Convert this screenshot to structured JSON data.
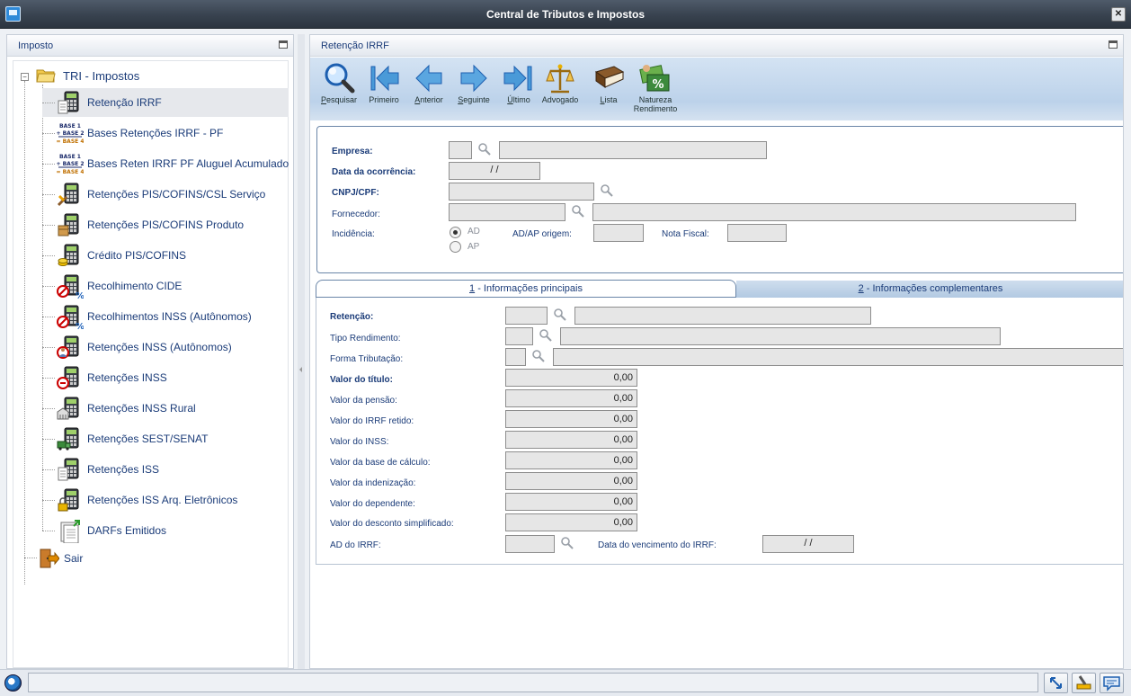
{
  "window": {
    "title": "Central de Tributos e Impostos"
  },
  "left": {
    "header": "Imposto",
    "root": "TRI - Impostos",
    "items": [
      {
        "label": "Retenção IRRF",
        "icon": "document-calculator-icon",
        "selected": true
      },
      {
        "label": "Bases Retenções IRRF - PF",
        "icon": "base-sum-icon"
      },
      {
        "label": "Bases Reten IRRF PF Aluguel Acumulado",
        "icon": "base-sum-icon"
      },
      {
        "label": "Retenções PIS/COFINS/CSL Serviço",
        "icon": "tools-calculator-icon"
      },
      {
        "label": "Retenções PIS/COFINS Produto",
        "icon": "box-calculator-icon"
      },
      {
        "label": "Crédito PIS/COFINS",
        "icon": "coins-calculator-icon"
      },
      {
        "label": "Recolhimento CIDE",
        "icon": "percent-calculator-icon"
      },
      {
        "label": "Recolhimentos INSS (Autônomos)",
        "icon": "percent-calculator-icon"
      },
      {
        "label": "Retenções INSS (Autônomos)",
        "icon": "person-calculator-icon"
      },
      {
        "label": "Retenções INSS",
        "icon": "calculator-badge-icon"
      },
      {
        "label": "Retenções INSS Rural",
        "icon": "building-calculator-icon"
      },
      {
        "label": "Retenções SEST/SENAT",
        "icon": "truck-calculator-icon"
      },
      {
        "label": "Retenções ISS",
        "icon": "document-calculator-icon"
      },
      {
        "label": "Retenções ISS Arq. Eletrônicos",
        "icon": "lock-calculator-icon"
      },
      {
        "label": "DARFs Emitidos",
        "icon": "documents-arrow-icon"
      }
    ],
    "exit": "Sair"
  },
  "right": {
    "header": "Retenção IRRF",
    "toolbar": [
      {
        "label": "Pesquisar",
        "u": "P",
        "rest": "esquisar",
        "icon": "magnifier-icon"
      },
      {
        "label": "Primeiro",
        "u": "",
        "rest": "Primeiro",
        "icon": "first-arrow-icon"
      },
      {
        "label": "Anterior",
        "u": "A",
        "rest": "nterior",
        "icon": "prev-arrow-icon"
      },
      {
        "label": "Seguinte",
        "u": "S",
        "rest": "eguinte",
        "icon": "next-arrow-icon"
      },
      {
        "label": "Último",
        "u": "Ú",
        "rest": "ltimo",
        "icon": "last-arrow-icon"
      },
      {
        "label": "Advogado",
        "u": "",
        "rest": "Advogado",
        "icon": "scales-icon"
      },
      {
        "label": "Lista",
        "u": "L",
        "rest": "ista",
        "icon": "book-icon"
      },
      {
        "label": "Natureza Rendimento",
        "u": "",
        "rest": "Natureza",
        "rest2": "Rendimento",
        "icon": "money-percent-icon"
      }
    ],
    "form": {
      "empresa": "Empresa:",
      "data_ocorrencia": "Data da ocorrência:",
      "data_ocorrencia_value": "/ /",
      "cnpj": "CNPJ/CPF:",
      "fornecedor": "Fornecedor:",
      "incidencia": "Incidência:",
      "opt_ad": "AD",
      "opt_ap": "AP",
      "adap_origem": "AD/AP origem:",
      "nota_fiscal": "Nota Fiscal:"
    },
    "tabs": {
      "tab1_num": "1",
      "tab1_label": " - Informações principais",
      "tab2_num": "2",
      "tab2_label": " - Informações complementares"
    },
    "details": {
      "retencao": "Retenção:",
      "tipo_rendimento": "Tipo Rendimento:",
      "forma_tributacao": "Forma Tributação:",
      "valor_titulo": "Valor do título:",
      "valor_titulo_v": "0,00",
      "valor_pensao": "Valor da pensão:",
      "valor_pensao_v": "0,00",
      "valor_irrf": "Valor do IRRF retido:",
      "valor_irrf_v": "0,00",
      "valor_inss": "Valor do INSS:",
      "valor_inss_v": "0,00",
      "valor_base": "Valor da base de cálculo:",
      "valor_base_v": "0,00",
      "valor_indenizacao": "Valor da indenização:",
      "valor_indenizacao_v": "0,00",
      "valor_dependente": "Valor do dependente:",
      "valor_dependente_v": "0,00",
      "valor_desconto": "Valor do desconto simplificado:",
      "valor_desconto_v": "0,00",
      "ad_irrf": "AD do IRRF:",
      "data_venc": "Data do vencimento do IRRF:",
      "data_venc_v": "/ /"
    }
  }
}
